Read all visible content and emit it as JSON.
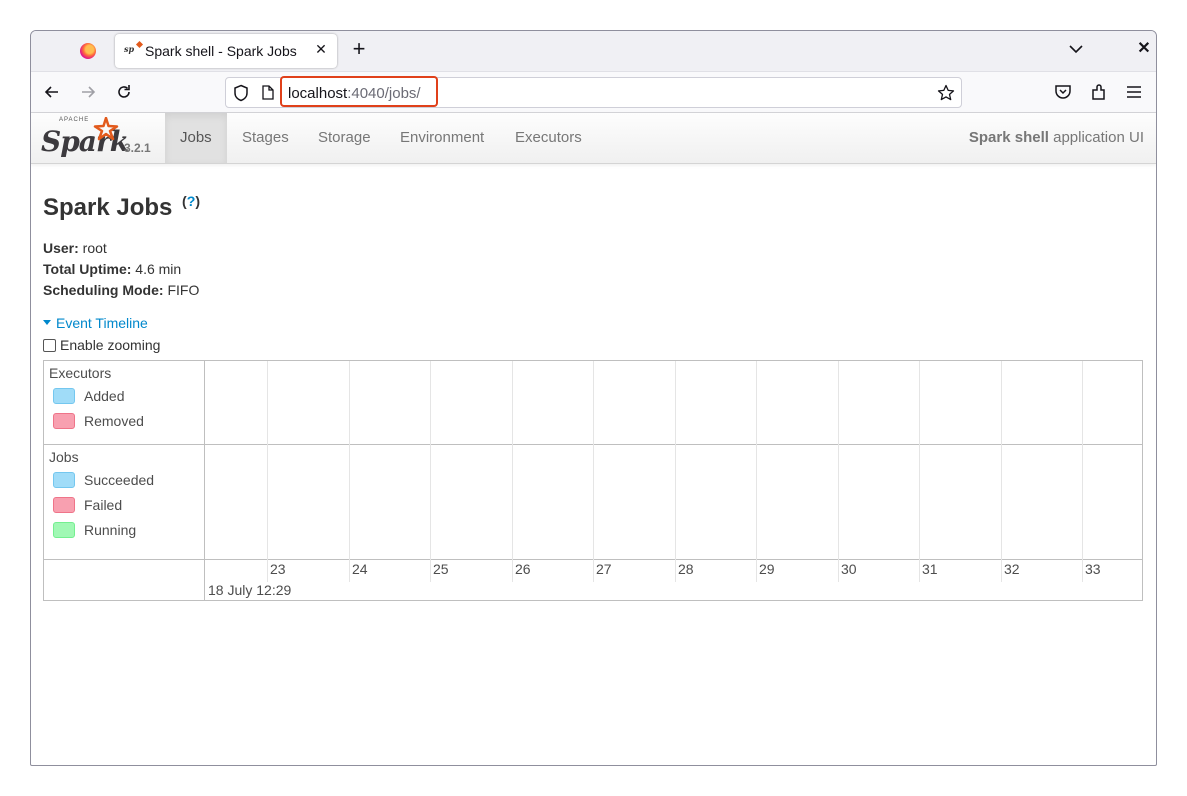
{
  "browser": {
    "tab_title": "Spark shell - Spark Jobs",
    "url_host": "localhost",
    "url_rest": ":4040/jobs/"
  },
  "spark_header": {
    "logo_small_text": "APACHE",
    "logo_text": "Spark",
    "version": "3.2.1",
    "tabs": [
      {
        "label": "Jobs",
        "active": true
      },
      {
        "label": "Stages"
      },
      {
        "label": "Storage"
      },
      {
        "label": "Environment"
      },
      {
        "label": "Executors"
      }
    ],
    "app_name": "Spark shell",
    "app_suffix": " application UI"
  },
  "page": {
    "title": "Spark Jobs",
    "help_open": "(",
    "help_q": "?",
    "help_close": ")",
    "summary": [
      {
        "label": "User:",
        "value": " root"
      },
      {
        "label": "Total Uptime:",
        "value": " 4.6 min"
      },
      {
        "label": "Scheduling Mode:",
        "value": " FIFO"
      }
    ],
    "event_timeline": "Event Timeline",
    "enable_zooming": "Enable zooming"
  },
  "timeline": {
    "executors": {
      "title": "Executors",
      "legend": [
        {
          "label": "Added",
          "color": "#a0dcf8",
          "border": "#74c7ef"
        },
        {
          "label": "Removed",
          "color": "#f8a0b0",
          "border": "#ef7489"
        }
      ]
    },
    "jobs": {
      "title": "Jobs",
      "legend": [
        {
          "label": "Succeeded",
          "color": "#a0dcf8",
          "border": "#74c7ef"
        },
        {
          "label": "Failed",
          "color": "#f8a0b0",
          "border": "#ef7489"
        },
        {
          "label": "Running",
          "color": "#a0f8b4",
          "border": "#74ef90"
        }
      ]
    },
    "ticks": [
      "23",
      "24",
      "25",
      "26",
      "27",
      "28",
      "29",
      "30",
      "31",
      "32",
      "33"
    ],
    "date_label": "18 July 12:29"
  }
}
